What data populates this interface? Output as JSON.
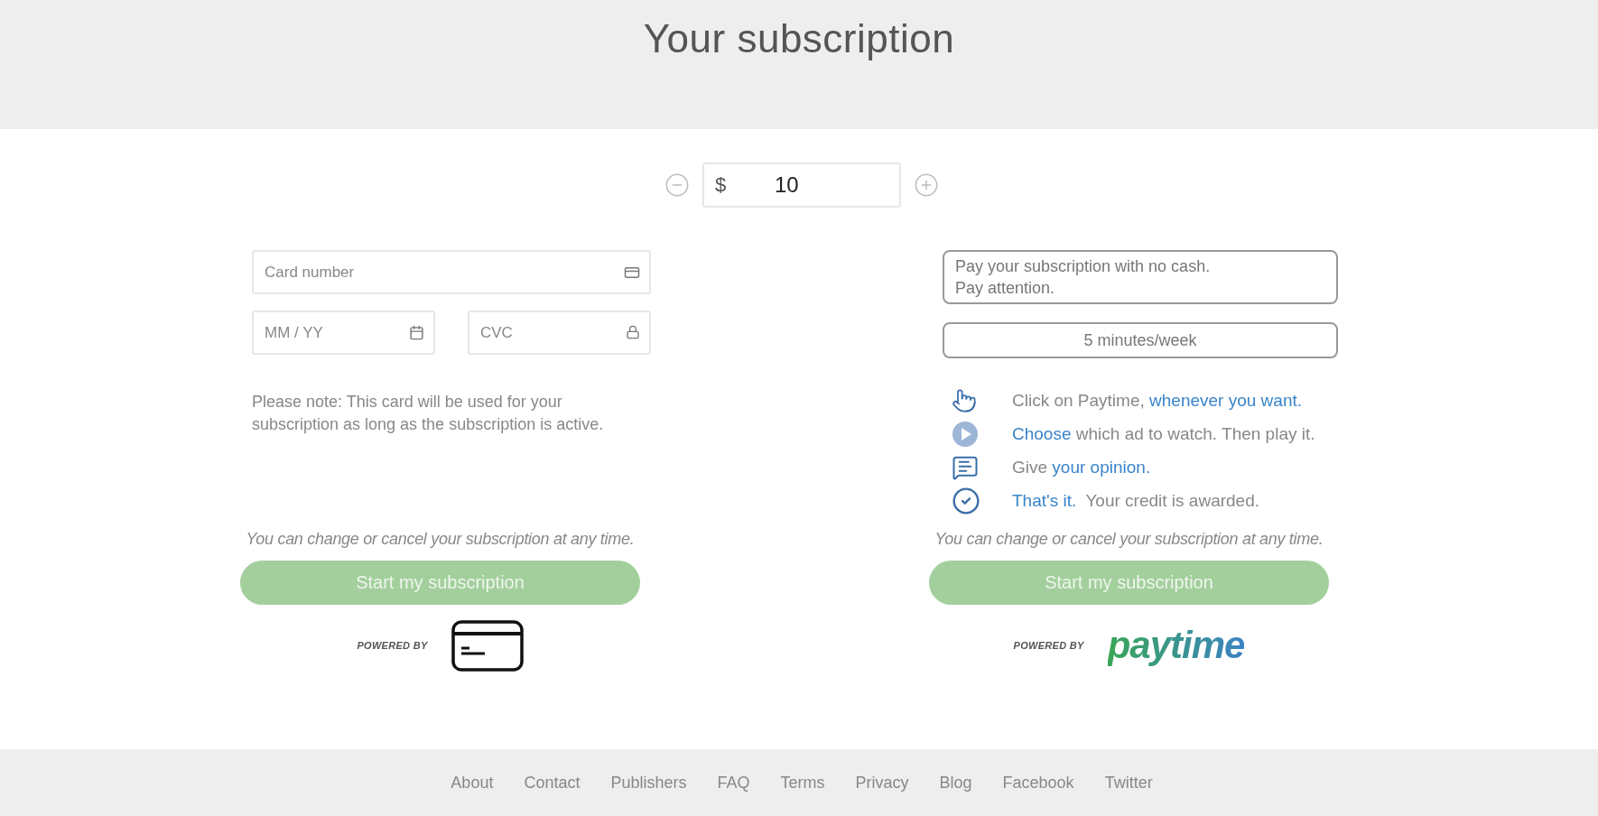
{
  "header": {
    "title": "Your subscription"
  },
  "amount": {
    "currency": "$",
    "value": "10"
  },
  "card_form": {
    "card_number": {
      "placeholder": "Card number"
    },
    "expiry": {
      "placeholder": "MM / YY"
    },
    "cvc": {
      "placeholder": "CVC"
    },
    "note": "Please note: This card will be used for your subscription as long as the subscription is active.",
    "disclaimer": "You can change or cancel your subscription at any time.",
    "button": "Start my subscription",
    "powered_by": "POWERED BY"
  },
  "paytime": {
    "intro": [
      "Pay your subscription  with no cash.",
      "Pay attention."
    ],
    "duration": "5 minutes/week",
    "steps": [
      {
        "kind": "click",
        "parts": [
          {
            "text": "Click on Paytime, ",
            "link": false
          },
          {
            "text": "whenever you want.",
            "link": true
          }
        ]
      },
      {
        "kind": "play",
        "parts": [
          {
            "text": "Choose",
            "link": true
          },
          {
            "text": " which ad to watch. Then play it.",
            "link": false
          }
        ]
      },
      {
        "kind": "opinion",
        "parts": [
          {
            "text": "Give ",
            "link": false
          },
          {
            "text": "your opinion.",
            "link": true
          }
        ]
      },
      {
        "kind": "done",
        "parts": [
          {
            "text": "That's it.",
            "link": true
          },
          {
            "text": "  Your credit is awarded.",
            "link": false
          }
        ]
      }
    ],
    "disclaimer": "You can change or cancel your subscription at any time.",
    "button": "Start my subscription",
    "powered_by": "POWERED BY",
    "logo": "paytime"
  },
  "footer": {
    "links": [
      "About",
      "Contact",
      "Publishers",
      "FAQ",
      "Terms",
      "Privacy",
      "Blog",
      "Facebook",
      "Twitter"
    ]
  }
}
